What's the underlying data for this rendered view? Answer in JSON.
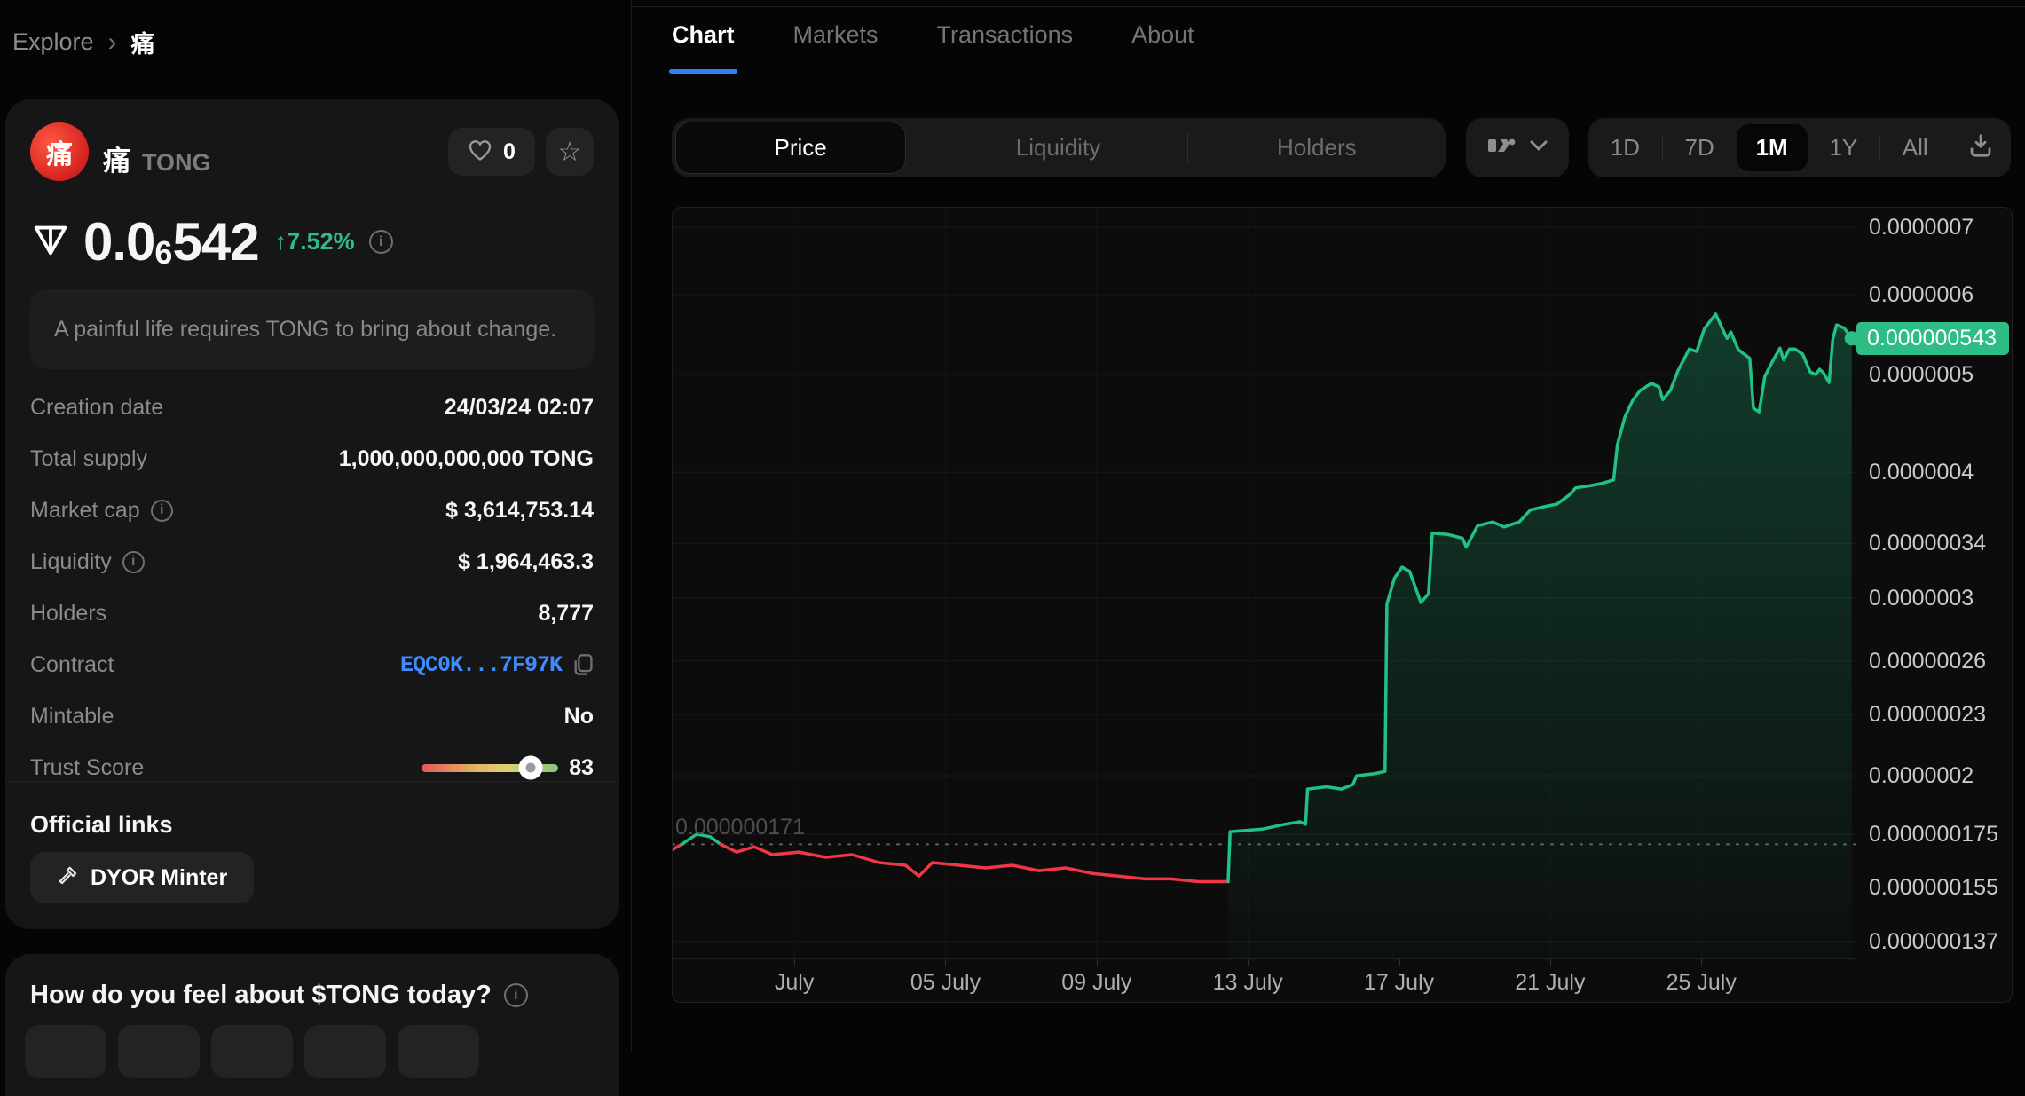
{
  "breadcrumb": {
    "root": "Explore",
    "chevron": "›",
    "current": "痛"
  },
  "header": {
    "logo_char": "痛",
    "title": "痛",
    "ticker": "TONG",
    "likes": "0"
  },
  "price": {
    "prefix": "0.0",
    "subscript": "6",
    "digits": "542",
    "change": "↑7.52%"
  },
  "description": "A painful life requires TONG to bring about change.",
  "stats": {
    "rows": [
      {
        "label": "Creation date",
        "value": "24/03/24 02:07",
        "type": "text",
        "info": false
      },
      {
        "label": "Total supply",
        "value": "1,000,000,000,000 TONG",
        "type": "text",
        "info": false
      },
      {
        "label": "Market cap",
        "value": "$ 3,614,753.14",
        "type": "text",
        "info": true
      },
      {
        "label": "Liquidity",
        "value": "$ 1,964,463.3",
        "type": "text",
        "info": true
      },
      {
        "label": "Holders",
        "value": "8,777",
        "type": "text",
        "info": false
      },
      {
        "label": "Contract",
        "value": "EQC0K...7F97K",
        "type": "contract",
        "info": false
      },
      {
        "label": "Mintable",
        "value": "No",
        "type": "text",
        "info": false
      },
      {
        "label": "Trust Score",
        "value": "83",
        "type": "slider",
        "info": false,
        "slider_percent": 80
      }
    ]
  },
  "official_links": {
    "heading": "Official links",
    "buttons": [
      {
        "icon": "hammer-icon",
        "label": "DYOR Minter"
      }
    ]
  },
  "sentiment": {
    "question": "How do you feel about $TONG today?",
    "option_count": 5
  },
  "nav_tabs": {
    "items": [
      "Chart",
      "Markets",
      "Transactions",
      "About"
    ],
    "active": "Chart"
  },
  "chart_controls": {
    "metric_toggle": {
      "items": [
        "Price",
        "Liquidity",
        "Holders"
      ],
      "active": "Price"
    },
    "timeframes": {
      "items": [
        "1D",
        "7D",
        "1M",
        "1Y",
        "All"
      ],
      "active": "1M"
    }
  },
  "icons": {
    "info": "i",
    "star": "☆"
  },
  "chart_data": {
    "type": "area",
    "scale": "log",
    "title": "TONG price, 1M view",
    "x_unit": "days since 28 June",
    "x_range": [
      0,
      31.3
    ],
    "x_ticks": [
      {
        "label": "July",
        "t": 3.22
      },
      {
        "label": "05 July",
        "t": 7.22
      },
      {
        "label": "09 July",
        "t": 11.22
      },
      {
        "label": "13 July",
        "t": 15.22
      },
      {
        "label": "17 July",
        "t": 19.22
      },
      {
        "label": "21 July",
        "t": 23.22
      },
      {
        "label": "25 July",
        "t": 27.22
      }
    ],
    "price_unit": 1e-07,
    "y_ticks": [
      {
        "label": "0.0000007",
        "p": 7
      },
      {
        "label": "0.0000006",
        "p": 6
      },
      {
        "label": "0.0000005",
        "p": 5
      },
      {
        "label": "0.0000004",
        "p": 4
      },
      {
        "label": "0.00000034",
        "p": 3.4
      },
      {
        "label": "0.0000003",
        "p": 3
      },
      {
        "label": "0.00000026",
        "p": 2.6
      },
      {
        "label": "0.00000023",
        "p": 2.3
      },
      {
        "label": "0.0000002",
        "p": 2
      },
      {
        "label": "0.000000175",
        "p": 1.75
      },
      {
        "label": "0.000000155",
        "p": 1.55
      },
      {
        "label": "0.000000137",
        "p": 1.37
      }
    ],
    "baseline": {
      "label": "0.000000171",
      "p": 1.71
    },
    "current": {
      "label": "0.000000543",
      "p": 5.43
    },
    "colors": {
      "up": "#21c183",
      "down": "#f23645",
      "tag": "#2ebd85"
    },
    "segments": [
      {
        "dir": "down",
        "points": [
          [
            0,
            1.69
          ],
          [
            0.24,
            1.71
          ]
        ]
      },
      {
        "dir": "up",
        "points": [
          [
            0.24,
            1.71
          ],
          [
            0.64,
            1.75
          ],
          [
            0.99,
            1.74
          ],
          [
            1.27,
            1.71
          ]
        ]
      },
      {
        "dir": "down",
        "points": [
          [
            1.27,
            1.71
          ],
          [
            1.69,
            1.68
          ],
          [
            2.16,
            1.7
          ],
          [
            2.64,
            1.67
          ],
          [
            3.34,
            1.68
          ],
          [
            4.05,
            1.66
          ],
          [
            4.75,
            1.67
          ],
          [
            5.46,
            1.64
          ],
          [
            6.16,
            1.63
          ],
          [
            6.52,
            1.59
          ],
          [
            6.87,
            1.64
          ],
          [
            7.58,
            1.63
          ],
          [
            8.28,
            1.62
          ],
          [
            8.99,
            1.63
          ],
          [
            9.69,
            1.61
          ],
          [
            10.4,
            1.62
          ],
          [
            11.1,
            1.6
          ],
          [
            11.8,
            1.59
          ],
          [
            12.5,
            1.58
          ],
          [
            13.2,
            1.58
          ],
          [
            13.9,
            1.57
          ],
          [
            14.7,
            1.57
          ]
        ]
      },
      {
        "dir": "up",
        "fill": true,
        "points": [
          [
            14.7,
            1.57
          ],
          [
            14.75,
            1.76
          ],
          [
            15.6,
            1.77
          ],
          [
            16.2,
            1.79
          ],
          [
            16.6,
            1.8
          ],
          [
            16.75,
            1.79
          ],
          [
            16.8,
            1.94
          ],
          [
            17.3,
            1.95
          ],
          [
            17.7,
            1.94
          ],
          [
            18.0,
            1.96
          ],
          [
            18.1,
            2.0
          ],
          [
            18.6,
            2.01
          ],
          [
            18.85,
            2.02
          ],
          [
            18.9,
            2.96
          ],
          [
            19.1,
            3.14
          ],
          [
            19.3,
            3.22
          ],
          [
            19.5,
            3.19
          ],
          [
            19.8,
            2.97
          ],
          [
            20.0,
            3.03
          ],
          [
            20.1,
            3.48
          ],
          [
            20.5,
            3.47
          ],
          [
            20.9,
            3.44
          ],
          [
            21.0,
            3.37
          ],
          [
            21.3,
            3.54
          ],
          [
            21.7,
            3.57
          ],
          [
            22.0,
            3.53
          ],
          [
            22.4,
            3.57
          ],
          [
            22.7,
            3.67
          ],
          [
            23.1,
            3.7
          ],
          [
            23.4,
            3.72
          ],
          [
            23.7,
            3.79
          ],
          [
            23.9,
            3.86
          ],
          [
            24.3,
            3.88
          ],
          [
            24.6,
            3.9
          ],
          [
            24.9,
            3.93
          ],
          [
            25.0,
            4.26
          ],
          [
            25.2,
            4.54
          ],
          [
            25.4,
            4.71
          ],
          [
            25.6,
            4.82
          ],
          [
            25.9,
            4.9
          ],
          [
            26.1,
            4.86
          ],
          [
            26.2,
            4.72
          ],
          [
            26.4,
            4.82
          ],
          [
            26.6,
            5.04
          ],
          [
            26.9,
            5.3
          ],
          [
            27.1,
            5.27
          ],
          [
            27.3,
            5.55
          ],
          [
            27.6,
            5.74
          ],
          [
            27.8,
            5.53
          ],
          [
            27.9,
            5.43
          ],
          [
            28.0,
            5.51
          ],
          [
            28.2,
            5.29
          ],
          [
            28.5,
            5.19
          ],
          [
            28.6,
            4.63
          ],
          [
            28.75,
            4.59
          ],
          [
            28.9,
            4.98
          ],
          [
            29.1,
            5.15
          ],
          [
            29.3,
            5.31
          ],
          [
            29.4,
            5.17
          ],
          [
            29.55,
            5.3
          ],
          [
            29.7,
            5.3
          ],
          [
            29.9,
            5.24
          ],
          [
            30.1,
            5.03
          ],
          [
            30.25,
            5.0
          ],
          [
            30.35,
            5.06
          ],
          [
            30.45,
            5.02
          ],
          [
            30.6,
            4.91
          ],
          [
            30.7,
            5.42
          ],
          [
            30.8,
            5.6
          ],
          [
            31.0,
            5.56
          ],
          [
            31.2,
            5.43
          ]
        ]
      }
    ]
  }
}
